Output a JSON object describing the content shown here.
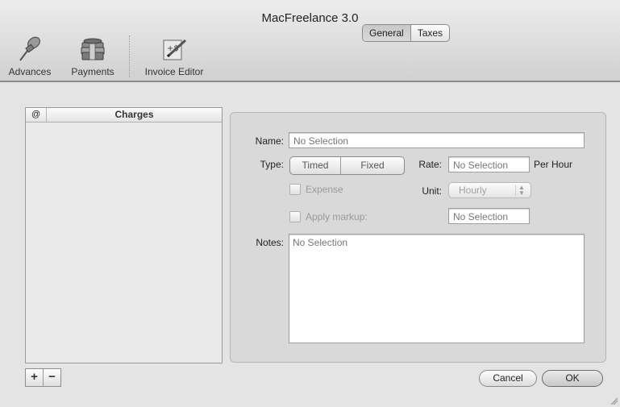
{
  "window": {
    "title": "MacFreelance 3.0"
  },
  "toolbar": {
    "items": [
      {
        "label": "Advances",
        "icon": "pushpin-icon"
      },
      {
        "label": "Payments",
        "icon": "money-stack-icon"
      },
      {
        "label": "Invoice Editor",
        "icon": "invoice-pencil-icon"
      }
    ]
  },
  "charges_list": {
    "column_at": "@",
    "column_charges": "Charges",
    "add_label": "+",
    "remove_label": "−"
  },
  "tabs": {
    "general": "General",
    "taxes": "Taxes",
    "selected": "General"
  },
  "form": {
    "name_label": "Name:",
    "name_value": "No Selection",
    "type_label": "Type:",
    "type_timed": "Timed",
    "type_fixed": "Fixed",
    "rate_label": "Rate:",
    "rate_value": "No Selection",
    "rate_suffix": "Per Hour",
    "expense_label": "Expense",
    "unit_label": "Unit:",
    "unit_value": "Hourly",
    "apply_markup_label": "Apply markup:",
    "markup_value": "No Selection",
    "notes_label": "Notes:",
    "notes_value": "No Selection"
  },
  "buttons": {
    "cancel": "Cancel",
    "ok": "OK"
  },
  "colors": {
    "window_bg": "#e3e3e3",
    "panel_bg": "#d9d9d9",
    "disabled_text": "#9a9a9a"
  }
}
